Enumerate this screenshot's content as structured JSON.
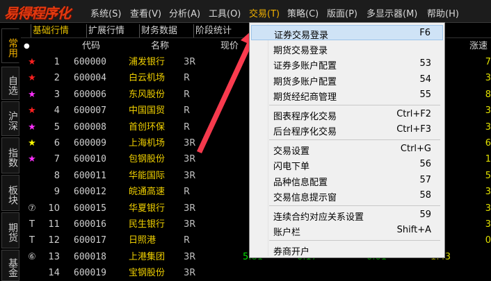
{
  "app": {
    "logo": "易得程序化"
  },
  "menu": [
    {
      "label": "系统(S)",
      "active": false
    },
    {
      "label": "查看(V)",
      "active": false
    },
    {
      "label": "分析(A)",
      "active": false
    },
    {
      "label": "工具(O)",
      "active": false
    },
    {
      "label": "交易(T)",
      "active": true
    },
    {
      "label": "策略(C)",
      "active": false
    },
    {
      "label": "版面(P)",
      "active": false
    },
    {
      "label": "多显示器(M)",
      "active": false
    },
    {
      "label": "帮助(H)",
      "active": false
    }
  ],
  "sidetabs": [
    "常用",
    "自选",
    "沪深",
    "指数",
    "板块",
    "期货",
    "基金"
  ],
  "subtabs": [
    "基础行情",
    "扩展行情",
    "财务数据",
    "阶段统计"
  ],
  "table": {
    "headers": {
      "code": "代码",
      "name": "名称",
      "price": "现价",
      "tail": "涨速"
    },
    "rows": [
      {
        "star": "★",
        "star_color": "#ff2020",
        "idx": "1",
        "code": "600000",
        "name": "浦发银行",
        "flag": "3R",
        "price": "12.",
        "price_c": "up",
        "tail": "7"
      },
      {
        "star": "★",
        "star_color": "#ff2020",
        "idx": "2",
        "code": "600004",
        "name": "白云机场",
        "flag": "R",
        "price": "9.",
        "price_c": "up",
        "tail": "3"
      },
      {
        "star": "★",
        "star_color": "#ff30ff",
        "idx": "3",
        "code": "600006",
        "name": "东风股份",
        "flag": "R",
        "price": "6.",
        "price_c": "down",
        "tail": "8"
      },
      {
        "star": "★",
        "star_color": "#ff2020",
        "idx": "4",
        "code": "600007",
        "name": "中国国贸",
        "flag": "R",
        "price": "21.",
        "price_c": "up",
        "tail": "3"
      },
      {
        "star": "★",
        "star_color": "#ff30ff",
        "idx": "5",
        "code": "600008",
        "name": "首创环保",
        "flag": "R",
        "price": "3.",
        "price_c": "down",
        "tail": "3"
      },
      {
        "star": "★",
        "star_color": "#ffff00",
        "idx": "6",
        "code": "600009",
        "name": "上海机场",
        "flag": "3R",
        "price": "32.",
        "price_c": "up",
        "tail": "6"
      },
      {
        "star": "★",
        "star_color": "#ff30ff",
        "idx": "7",
        "code": "600010",
        "name": "包钢股份",
        "flag": "3R",
        "price": "1.",
        "price_c": "yel",
        "tail": "1"
      },
      {
        "star": "",
        "star_color": "#ffffff",
        "idx": "8",
        "code": "600011",
        "name": "华能国际",
        "flag": "3R",
        "price": "7.",
        "price_c": "up",
        "tail": "5"
      },
      {
        "star": "",
        "star_color": "#ffffff",
        "idx": "9",
        "code": "600012",
        "name": "皖通高速",
        "flag": "R",
        "price": "7.",
        "price_c": "up",
        "tail": "3"
      },
      {
        "star": "⑦",
        "star_color": "#d0d0d0",
        "idx": "10",
        "code": "600015",
        "name": "华夏银行",
        "flag": "3R",
        "price": "7.",
        "price_c": "down",
        "tail": "3"
      },
      {
        "star": "T",
        "star_color": "#d0d0d0",
        "idx": "11",
        "code": "600016",
        "name": "民生银行",
        "flag": "3R",
        "price": "4.",
        "price_c": "down",
        "tail": "3"
      },
      {
        "star": "T",
        "star_color": "#d0d0d0",
        "idx": "12",
        "code": "600017",
        "name": "日照港",
        "flag": "R",
        "price": "3.",
        "price_c": "down",
        "tail": "0"
      },
      {
        "star": "⑥",
        "star_color": "#d0d0d0",
        "idx": "13",
        "code": "600018",
        "name": "上港集团",
        "flag": "3R",
        "price": "5.81",
        "price_c": "down",
        "chg": "-0.17",
        "chg_c": "down",
        "pct": "-0.01",
        "pct_c": "down",
        "vol": "1.43",
        "vol_c": "yel",
        "tail": ""
      },
      {
        "star": "",
        "star_color": "#d0d0d0",
        "idx": "14",
        "code": "600019",
        "name": "宝钢股份",
        "flag": "3R",
        "price": "",
        "price_c": "down",
        "tail": ""
      }
    ]
  },
  "trade_menu": {
    "groups": [
      [
        {
          "label": "证券交易登录",
          "shortcut": "F6",
          "highlight": true
        },
        {
          "label": "期货交易登录",
          "shortcut": ""
        },
        {
          "label": "证券多账户配置",
          "shortcut": "53"
        },
        {
          "label": "期货多账户配置",
          "shortcut": "54"
        },
        {
          "label": "期货经纪商管理",
          "shortcut": "55"
        }
      ],
      [
        {
          "label": "图表程序化交易",
          "shortcut": "Ctrl+F2"
        },
        {
          "label": "后台程序化交易",
          "shortcut": "Ctrl+F3"
        }
      ],
      [
        {
          "label": "交易设置",
          "shortcut": "Ctrl+G"
        },
        {
          "label": "闪电下单",
          "shortcut": "56"
        },
        {
          "label": "品种信息配置",
          "shortcut": "57"
        },
        {
          "label": "交易信息提示窗",
          "shortcut": "58"
        }
      ],
      [
        {
          "label": "连续合约对应关系设置",
          "shortcut": "59"
        },
        {
          "label": "账户栏",
          "shortcut": "Shift+A"
        }
      ],
      [
        {
          "label": "券商开户",
          "shortcut": ""
        }
      ]
    ]
  },
  "colors": {
    "up": "#ff3232",
    "down": "#00e000",
    "accent": "#f0b000",
    "arrow": "#ff3c50"
  }
}
